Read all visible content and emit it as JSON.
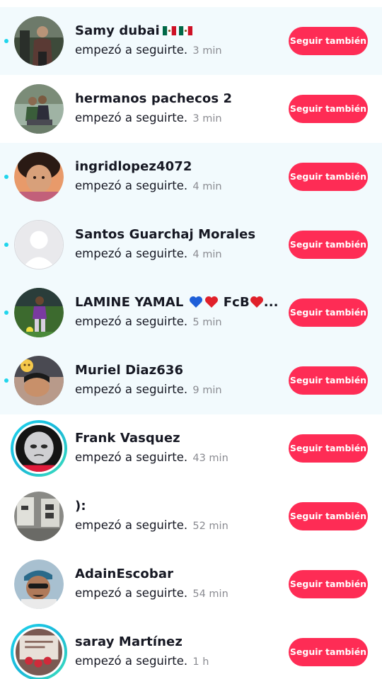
{
  "colors": {
    "accent": "#fe2c55",
    "unread_bg": "#f2fafd",
    "unread_dot": "#20d5ec",
    "secondary_text": "#8a8b91"
  },
  "notifications": [
    {
      "name": "Samy dubai",
      "name_icons": [
        "mexico-flag-icon",
        "mexico-flag-icon"
      ],
      "action": "empezó a seguirte.",
      "time": "3 min",
      "button": "Seguir también",
      "unread": true
    },
    {
      "name": "hermanos pachecos 2",
      "action": "empezó a seguirte.",
      "time": "3 min",
      "button": "Seguir también",
      "unread": false
    },
    {
      "name": "ingridlopez4072",
      "action": "empezó a seguirte.",
      "time": "4 min",
      "button": "Seguir también",
      "unread": true
    },
    {
      "name": "Santos Guarchaj Morales",
      "action": "empezó a seguirte.",
      "time": "4 min",
      "button": "Seguir también",
      "unread": true
    },
    {
      "name": "LAMINE YAMAL",
      "name_icons": [
        "blue-heart-icon",
        "red-heart-icon"
      ],
      "name_suffix": "FcB",
      "name_icons_after": [
        "red-heart-icon"
      ],
      "name_ellipsis": "...",
      "action": "empezó a seguirte.",
      "time": "5 min",
      "button": "Seguir también",
      "unread": true
    },
    {
      "name": "Muriel Diaz636",
      "action": "empezó a seguirte.",
      "time": "9 min",
      "button": "Seguir también",
      "unread": true
    },
    {
      "name": "Frank Vasquez",
      "action": "empezó a seguirte.",
      "time": "43 min",
      "button": "Seguir también",
      "unread": false,
      "story_ring": true
    },
    {
      "name": "):",
      "action": "empezó a seguirte.",
      "time": "52 min",
      "button": "Seguir también",
      "unread": false
    },
    {
      "name": "AdainEscobar",
      "action": "empezó a seguirte.",
      "time": "54 min",
      "button": "Seguir también",
      "unread": false
    },
    {
      "name": "saray Martínez",
      "action": "empezó a seguirte.",
      "time": "1 h",
      "button": "Seguir también",
      "unread": false,
      "story_ring": true
    }
  ]
}
